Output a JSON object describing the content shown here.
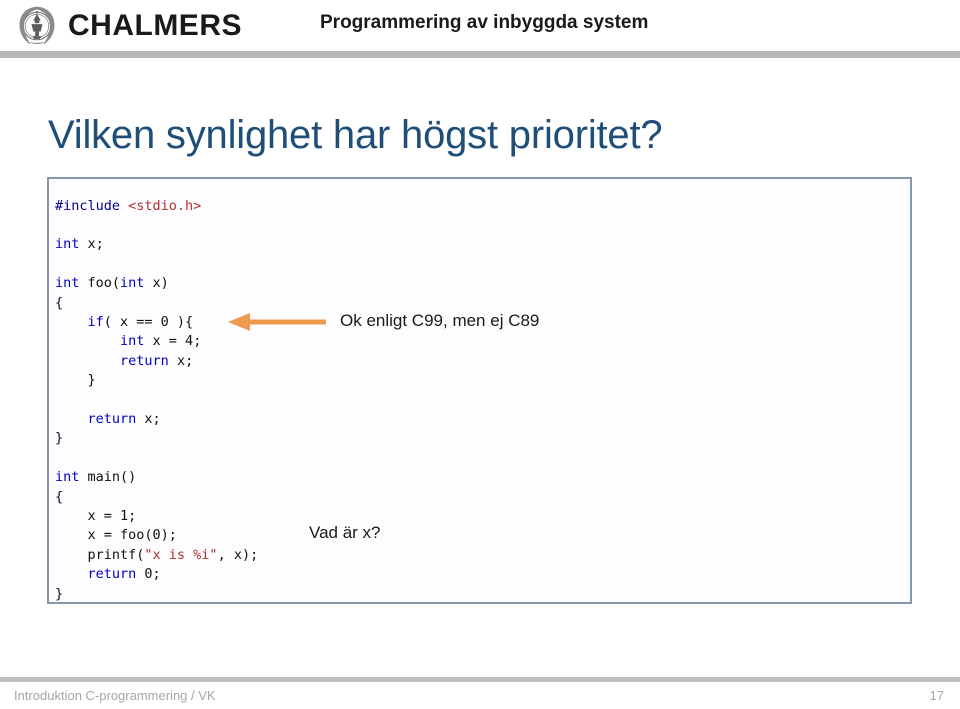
{
  "header": {
    "logo_text": "CHALMERS",
    "logo_icon": "chalmers-seal-icon",
    "course_title": "Programmering av inbyggda system"
  },
  "slide": {
    "title": "Vilken synlighet har högst prioritet?",
    "title_color": "#1F4E79"
  },
  "code": {
    "language": "c",
    "lines": [
      [
        {
          "t": "#include ",
          "c": "inc"
        },
        {
          "t": "<stdio.h>",
          "c": "str"
        }
      ],
      [],
      [
        {
          "t": "int",
          "c": "kw"
        },
        {
          "t": " x;",
          "c": "pl"
        }
      ],
      [],
      [
        {
          "t": "int",
          "c": "kw"
        },
        {
          "t": " foo(",
          "c": "pl"
        },
        {
          "t": "int",
          "c": "kw"
        },
        {
          "t": " x)",
          "c": "pl"
        }
      ],
      [
        {
          "t": "{",
          "c": "pl"
        }
      ],
      [
        {
          "t": "    ",
          "c": "pl"
        },
        {
          "t": "if",
          "c": "kw"
        },
        {
          "t": "( x == 0 ){",
          "c": "pl"
        }
      ],
      [
        {
          "t": "        ",
          "c": "pl"
        },
        {
          "t": "int",
          "c": "kw"
        },
        {
          "t": " x = 4;",
          "c": "pl"
        }
      ],
      [
        {
          "t": "        ",
          "c": "pl"
        },
        {
          "t": "return",
          "c": "kw"
        },
        {
          "t": " x;",
          "c": "pl"
        }
      ],
      [
        {
          "t": "    }",
          "c": "pl"
        }
      ],
      [],
      [
        {
          "t": "    ",
          "c": "pl"
        },
        {
          "t": "return",
          "c": "kw"
        },
        {
          "t": " x;",
          "c": "pl"
        }
      ],
      [
        {
          "t": "}",
          "c": "pl"
        }
      ],
      [],
      [
        {
          "t": "int",
          "c": "kw"
        },
        {
          "t": " main()",
          "c": "pl"
        }
      ],
      [
        {
          "t": "{",
          "c": "pl"
        }
      ],
      [
        {
          "t": "    x = 1;",
          "c": "pl"
        }
      ],
      [
        {
          "t": "    x = foo(0);",
          "c": "pl"
        }
      ],
      [
        {
          "t": "    printf(",
          "c": "pl"
        },
        {
          "t": "\"x is %i\"",
          "c": "str"
        },
        {
          "t": ", x);",
          "c": "pl"
        }
      ],
      [
        {
          "t": "    ",
          "c": "pl"
        },
        {
          "t": "return",
          "c": "kw"
        },
        {
          "t": " 0;",
          "c": "pl"
        }
      ],
      [
        {
          "t": "}",
          "c": "pl"
        }
      ]
    ],
    "colors": {
      "keyword": "#0000c0",
      "string": "#b03030",
      "preprocessor": "#00008b",
      "plain": "#111111",
      "border": "#8496a9"
    }
  },
  "annotations": {
    "arrow_color": "#ED9A4E",
    "arrow_label": "arrow-to-inner-declaration",
    "c99_note": "Ok enligt C99, men ej C89",
    "vad_note": "Vad är x?"
  },
  "footer": {
    "left_text": "Introduktion C-programmering / VK",
    "page_number": "17"
  }
}
